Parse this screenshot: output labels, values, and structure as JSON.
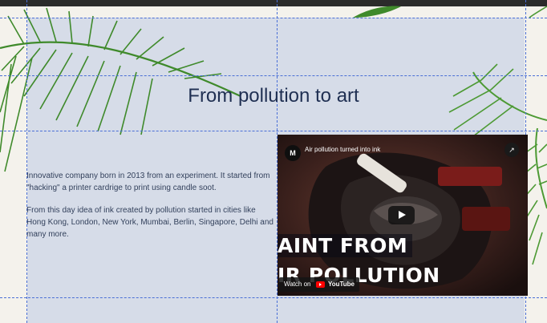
{
  "page": {
    "title": "From pollution to art",
    "paragraphs": [
      "Innovative company born in 2013 from an experiment. It started from \"hacking\" a printer cardrige to print using candle soot.",
      "From this day idea of ink created by pollution started in cities like Hong Kong, London, New York, Mumbai, Berlin, Singapore, Delhi and many more."
    ]
  },
  "video": {
    "channel_initial": "M",
    "title": "Air pollution turned into ink",
    "overlay_line1": "AINT FROM",
    "overlay_line2": "IR POLLUTION",
    "watch_on_label": "Watch on",
    "youtube_label": "YouTube",
    "icons": {
      "play": "play-icon",
      "share": "share-icon",
      "youtube": "youtube-logo"
    }
  },
  "colors": {
    "panel_background": "#d6dce8",
    "title_text": "#1f2f52",
    "guide_lines": "#4a6fd6",
    "leaf_green": "#3f8a2b"
  }
}
